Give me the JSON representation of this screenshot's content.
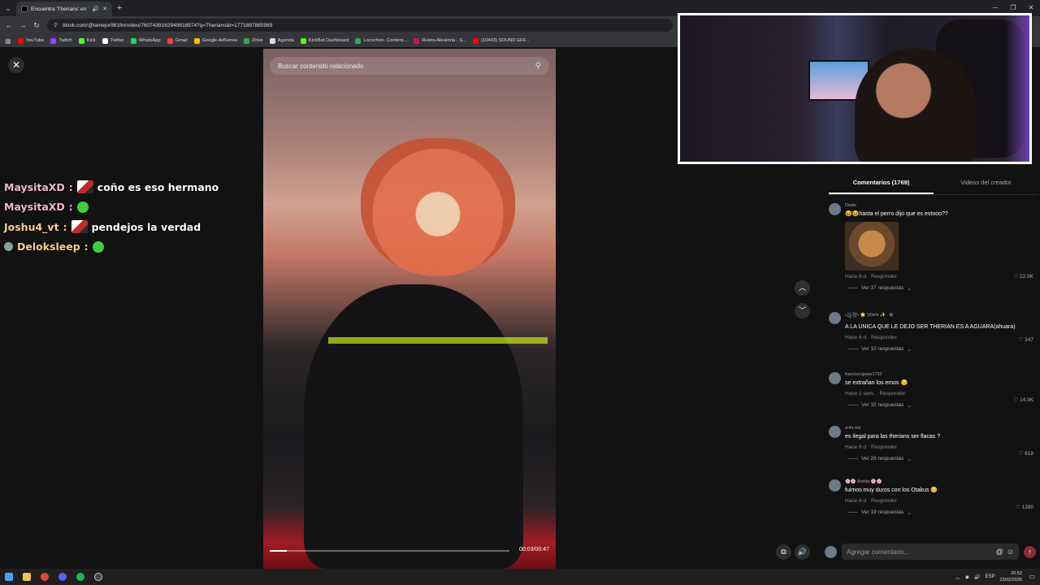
{
  "browser": {
    "tab_title": "Encuentra 'Therians' en Ti...",
    "url": "tiktok.com/@lamejor981fm/video/7607439162949618974?q=Therians&t=1771897885989",
    "bookmarks": [
      {
        "label": "YouTube",
        "color": "#ff0000"
      },
      {
        "label": "Twitch",
        "color": "#9146ff"
      },
      {
        "label": "Kick",
        "color": "#53fc18"
      },
      {
        "label": "Twitter",
        "color": "#ffffff"
      },
      {
        "label": "WhatsApp",
        "color": "#25d366"
      },
      {
        "label": "Gmail",
        "color": "#ea4335"
      },
      {
        "label": "Google AdSense",
        "color": "#fbbc04"
      },
      {
        "label": "Drive",
        "color": "#34a853"
      },
      {
        "label": "Agenda",
        "color": "#dddddd"
      },
      {
        "label": "KickBot Dashboard",
        "color": "#53fc18"
      },
      {
        "label": "Locochon- Content...",
        "color": "#34a853"
      },
      {
        "label": "Ruleta Aleatoria - S...",
        "color": "#c2185b"
      },
      {
        "label": "(10403) SOUND EFF...",
        "color": "#ff0000"
      }
    ]
  },
  "chat": [
    {
      "user": "MaysitaXD",
      "sep": ":",
      "emote": "image",
      "msg": "coño es eso hermano",
      "color": "pink"
    },
    {
      "user": "MaysitaXD",
      "sep": ":",
      "emote": "green",
      "msg": "",
      "color": "pink"
    },
    {
      "user": "Joshu4_vt",
      "sep": ":",
      "emote": "image",
      "msg": "pendejos la verdad",
      "color": "orange"
    },
    {
      "user": "Deloksleep",
      "sep": ":",
      "emote": "green",
      "msg": "",
      "color": "orange",
      "badge": true
    }
  ],
  "video": {
    "search_placeholder": "Buscar contenido relacionado",
    "time": "00:03/00:47",
    "progress": 0.07
  },
  "comments_panel": {
    "tab_comments": "Comentarios (1769)",
    "tab_creator": "Videos del creador",
    "comments": [
      {
        "user": "Deals",
        "text": "😆😆hasta el perro dijo que es estooo??",
        "time": "Hace 6 d",
        "reply": "Responder",
        "likes": "22.9K",
        "replies": "Ver 37 respuestas",
        "has_image": true
      },
      {
        "user": "꧁꧂ 🌟 {ส}ɐᶠɐ ✨ . ✿",
        "text": "A LA ÚNICA QUE LE DEJO SER THERIAN ES A AGUARA(ahuara)",
        "time": "Hace 6 d",
        "reply": "Responder",
        "likes": "347",
        "replies": "Ver 10 respuestas"
      },
      {
        "user": "franciscojavie1732",
        "text": "se extrañan los emos 😔",
        "time": "Hace 1 sem.",
        "reply": "Responder",
        "likes": "14.9K",
        "replies": "Ver 32 respuestas"
      },
      {
        "user": "znhr.ms",
        "text": "es ilegal para las therians ser flacas ?",
        "time": "Hace 6 d",
        "reply": "Responder",
        "likes": "618",
        "replies": "Ver 26 respuestas"
      },
      {
        "user": "🌸🌸 Arisita 🌸🌸",
        "text": "fuimos muy duros con los Otakus 😔",
        "time": "Hace 6 d",
        "reply": "Responder",
        "likes": "1390",
        "replies": "Ver 19 respuestas"
      }
    ],
    "input_placeholder": "Agregar comentario..."
  },
  "taskbar": {
    "lang": "ESP",
    "time": "20:52",
    "date": "23/02/2026"
  }
}
